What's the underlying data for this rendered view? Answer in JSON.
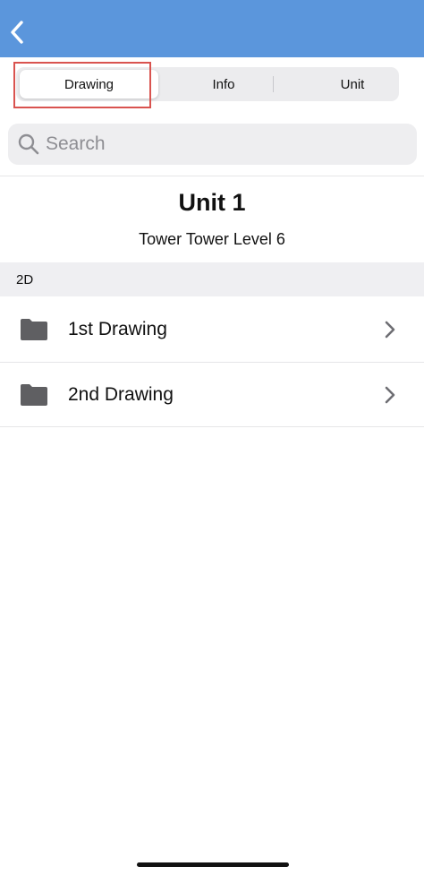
{
  "navbar": {
    "back_icon": "chevron-left-icon",
    "color": "#5b96dc"
  },
  "segments": {
    "drawing": "Drawing",
    "info": "Info",
    "unit": "Unit",
    "selected": "Drawing"
  },
  "search": {
    "placeholder": "Search",
    "value": ""
  },
  "header": {
    "title": "Unit 1",
    "subtitle": "Tower Tower Level 6"
  },
  "section": {
    "label": "2D"
  },
  "items": [
    {
      "label": "1st Drawing",
      "icon": "folder-icon"
    },
    {
      "label": "2nd Drawing",
      "icon": "folder-icon"
    }
  ],
  "colors": {
    "accent": "#5b96dc",
    "highlight": "#d9534f"
  }
}
